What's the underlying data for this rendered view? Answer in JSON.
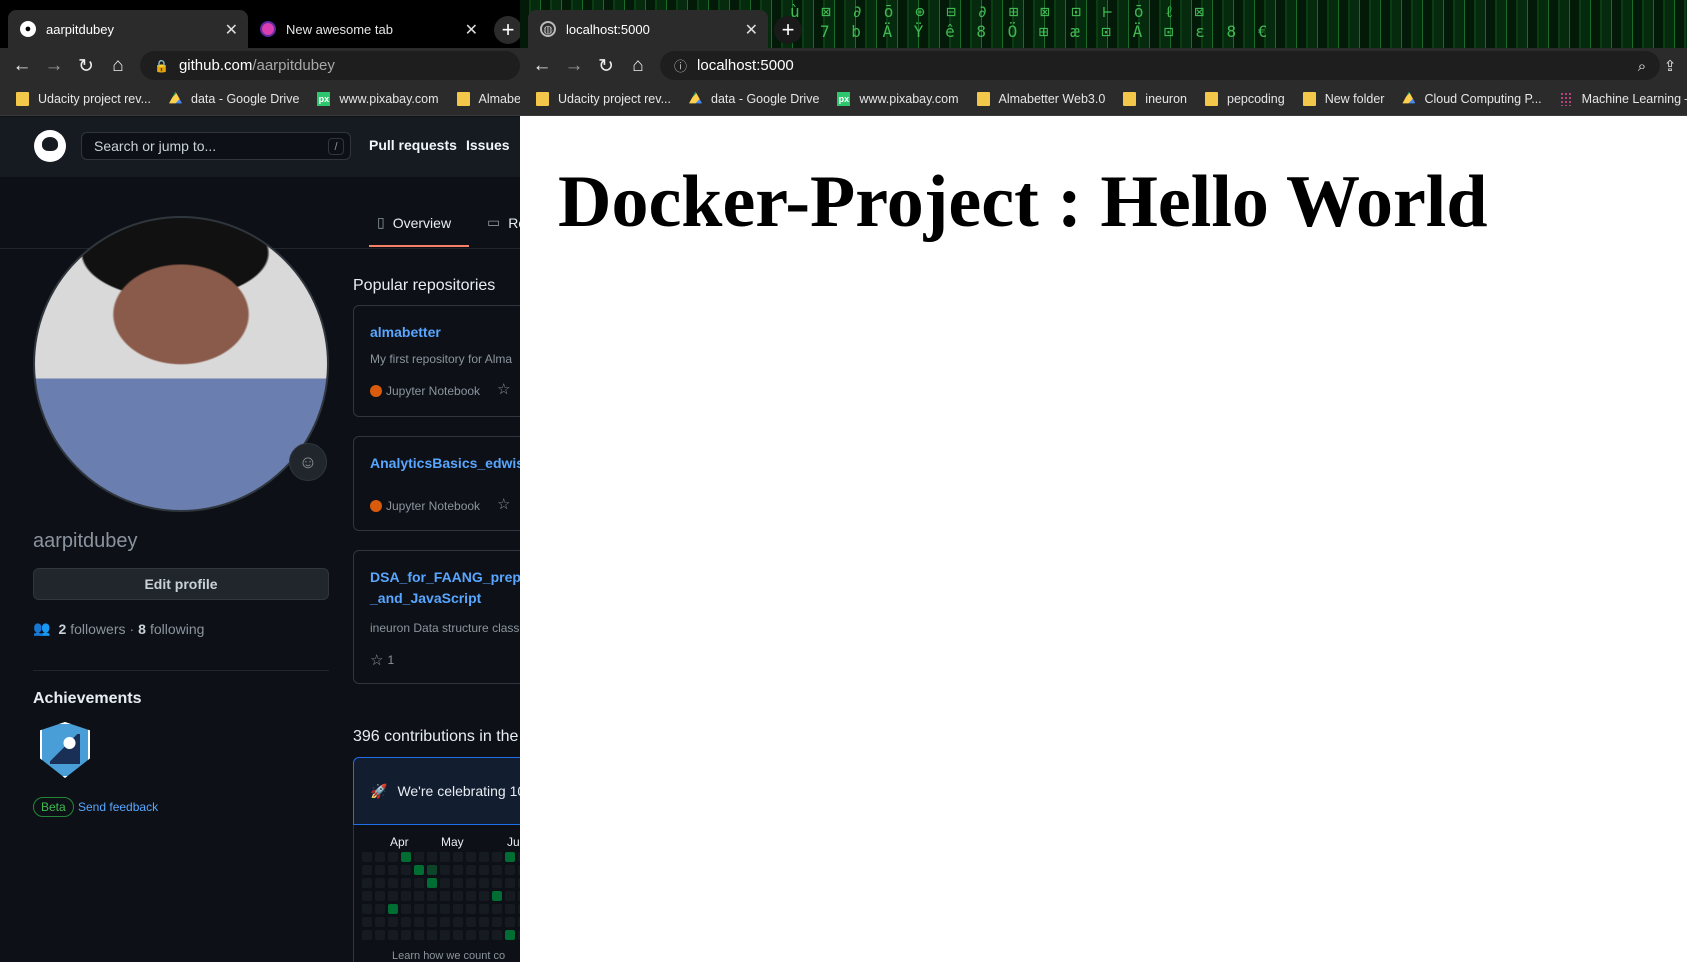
{
  "left_browser": {
    "tabs": [
      {
        "title": "aarpitdubey",
        "active": true,
        "icon": "github-icon"
      },
      {
        "title": "New awesome tab",
        "active": false,
        "icon": "custom-tab-icon"
      }
    ],
    "new_tab": "+",
    "address": {
      "host": "github.com",
      "path": "/aarpitdubey"
    },
    "bookmarks": [
      "Udacity project rev...",
      "data - Google Drive",
      "www.pixabay.com",
      "Almabett"
    ]
  },
  "github": {
    "search_placeholder": "Search or jump to...",
    "search_shortcut": "/",
    "nav": [
      "Pull requests",
      "Issues"
    ],
    "tabs": [
      "Overview",
      "Re"
    ],
    "username": "aarpitdubey",
    "edit_profile": "Edit profile",
    "followers_count": "2",
    "followers_label": "followers",
    "separator": "·",
    "following_count": "8",
    "following_label": "following",
    "achievements_title": "Achievements",
    "beta_label": "Beta",
    "send_feedback": "Send feedback",
    "popular_title": "Popular repositories",
    "repos": [
      {
        "name": "almabetter",
        "desc": "My first repository for Alma",
        "lang": "Jupyter Notebook"
      },
      {
        "name": "AnalyticsBasics_edwisor",
        "lang": "Jupyter Notebook"
      },
      {
        "name_line1": "DSA_for_FAANG_prepar",
        "name_line2": "_and_JavaScript",
        "desc": "ineuron Data structure classe",
        "stars": "1"
      }
    ],
    "contributions_title": "396 contributions in the",
    "celebrate_text": "We're celebrating 10",
    "months": [
      "Apr",
      "May",
      "Ju"
    ],
    "learn_text": "Learn how we count co",
    "colors": {
      "bg": "#0d1117",
      "header": "#161b22",
      "link": "#58a6ff",
      "border": "#30363d"
    }
  },
  "right_browser": {
    "tabs": [
      {
        "title": "localhost:5000",
        "active": true,
        "icon": "globe-icon"
      }
    ],
    "new_tab": "+",
    "address": "localhost:5000",
    "bookmarks": [
      "Udacity project rev...",
      "data - Google Drive",
      "www.pixabay.com",
      "Almabetter Web3.0",
      "ineuron",
      "pepcoding",
      "New folder",
      "Cloud Computing P...",
      "Machine Learning –..."
    ]
  },
  "page": {
    "heading": "Docker-Project : Hello World"
  }
}
